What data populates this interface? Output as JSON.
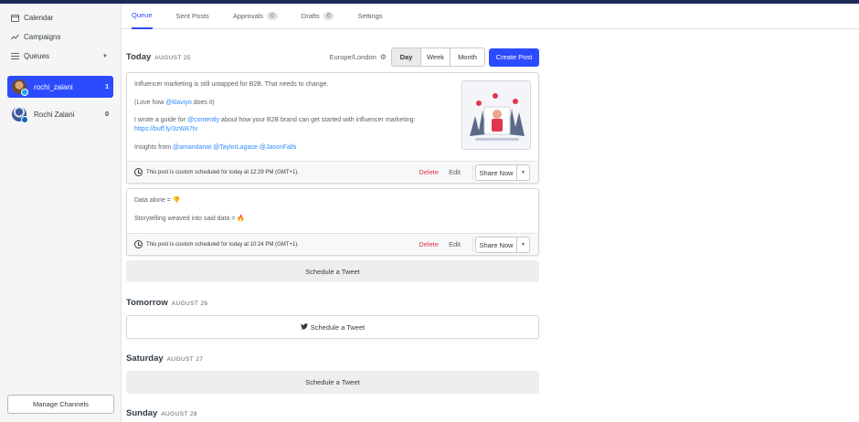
{
  "sidebar": {
    "nav": [
      {
        "label": "Calendar",
        "icon": "calendar-icon"
      },
      {
        "label": "Campaigns",
        "icon": "trend-icon"
      },
      {
        "label": "Queues",
        "icon": "list-icon"
      }
    ],
    "profiles": [
      {
        "name": "rochi_zalani",
        "count": "1",
        "network": "twitter",
        "active": true
      },
      {
        "name": "Rochi Zalani",
        "count": "0",
        "network": "linkedin",
        "active": false
      }
    ],
    "manage_label": "Manage Channels"
  },
  "tabs": [
    {
      "label": "Queue",
      "active": true
    },
    {
      "label": "Sent Posts"
    },
    {
      "label": "Approvals",
      "count": "0"
    },
    {
      "label": "Drafts",
      "count": "0"
    },
    {
      "label": "Settings"
    }
  ],
  "controls": {
    "timezone": "Europe/London",
    "views": [
      "Day",
      "Week",
      "Month"
    ],
    "active_view": "Day",
    "create_label": "Create Post"
  },
  "days": [
    {
      "name": "Today",
      "date": "AUGUST 25"
    },
    {
      "name": "Tomorrow",
      "date": "AUGUST 26"
    },
    {
      "name": "Saturday",
      "date": "AUGUST 27"
    },
    {
      "name": "Sunday",
      "date": "AUGUST 28"
    }
  ],
  "posts": [
    {
      "line1": "Influencer marketing is still untapped for B2B. That needs to change.",
      "line2_pre": "(Love how ",
      "line2_link": "@klaviyo",
      "line2_post": " does it)",
      "line3_pre": "I wrote a guide for ",
      "line3_link": "@contently",
      "line3_post": " about how your B2B brand can get started with influencer marketing:",
      "url": "https://buff.ly/3zWA7tv",
      "insights_pre": "Insights from ",
      "mentions": [
        "@amandanat",
        "@TaylorLagace",
        "@JasonFalls"
      ],
      "schedule_note": "This post is custom scheduled for today at 12:29 PM (GMT+1)."
    },
    {
      "line1": "Data alone = 👎",
      "line2": "Storytelling weaved into said data = 🔥",
      "schedule_note": "This post is custom scheduled for today at 10:24 PM (GMT+1)."
    }
  ],
  "post_actions": {
    "delete": "Delete",
    "edit": "Edit",
    "share": "Share Now"
  },
  "schedule_label": "Schedule a Tweet",
  "colors": {
    "accent": "#2c4bff",
    "delete": "#e0364f",
    "link": "#2c8bff",
    "topbar": "#1e2a5a"
  }
}
